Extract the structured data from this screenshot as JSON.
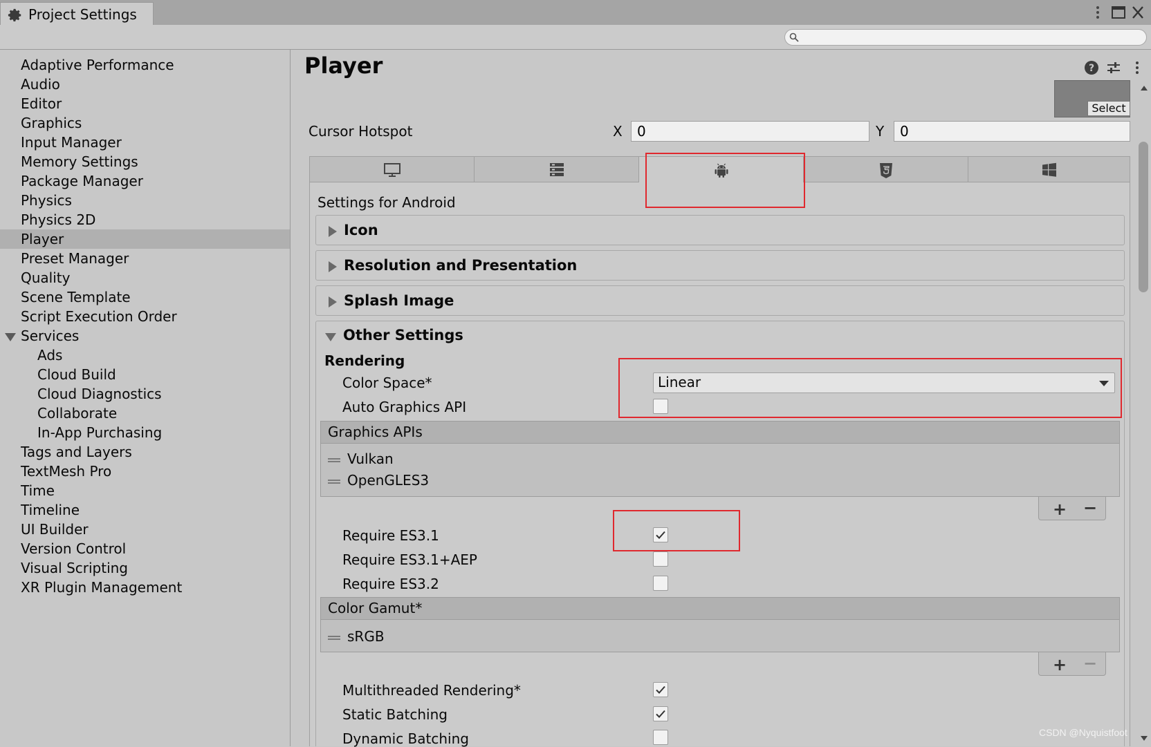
{
  "window": {
    "tab_title": "Project Settings",
    "search_placeholder": ""
  },
  "sidebar": {
    "items": [
      {
        "label": "Adaptive Performance"
      },
      {
        "label": "Audio"
      },
      {
        "label": "Editor"
      },
      {
        "label": "Graphics"
      },
      {
        "label": "Input Manager"
      },
      {
        "label": "Memory Settings"
      },
      {
        "label": "Package Manager"
      },
      {
        "label": "Physics"
      },
      {
        "label": "Physics 2D"
      },
      {
        "label": "Player"
      },
      {
        "label": "Preset Manager"
      },
      {
        "label": "Quality"
      },
      {
        "label": "Scene Template"
      },
      {
        "label": "Script Execution Order"
      },
      {
        "label": "Services"
      },
      {
        "label": "Ads"
      },
      {
        "label": "Cloud Build"
      },
      {
        "label": "Cloud Diagnostics"
      },
      {
        "label": "Collaborate"
      },
      {
        "label": "In-App Purchasing"
      },
      {
        "label": "Tags and Layers"
      },
      {
        "label": "TextMesh Pro"
      },
      {
        "label": "Time"
      },
      {
        "label": "Timeline"
      },
      {
        "label": "UI Builder"
      },
      {
        "label": "Version Control"
      },
      {
        "label": "Visual Scripting"
      },
      {
        "label": "XR Plugin Management"
      }
    ],
    "selected": "Player"
  },
  "main": {
    "title": "Player",
    "select_label": "Select",
    "cursor_hotspot": {
      "label": "Cursor Hotspot",
      "x_label": "X",
      "x_value": "0",
      "y_label": "Y",
      "y_value": "0"
    },
    "platform_tabs": [
      {
        "name": "standalone",
        "icon": "monitor-icon"
      },
      {
        "name": "server",
        "icon": "server-icon"
      },
      {
        "name": "android",
        "icon": "android-icon",
        "selected": true
      },
      {
        "name": "webgl",
        "icon": "html5-icon"
      },
      {
        "name": "windows",
        "icon": "windows-icon"
      }
    ],
    "settings_for": "Settings for Android",
    "sections": {
      "icon": "Icon",
      "resolution": "Resolution and Presentation",
      "splash": "Splash Image",
      "other": "Other Settings"
    },
    "rendering": {
      "header": "Rendering",
      "color_space_label": "Color Space*",
      "color_space_value": "Linear",
      "auto_graphics_api_label": "Auto Graphics API",
      "auto_graphics_api_checked": false,
      "graphics_apis_header": "Graphics APIs",
      "graphics_apis": [
        "Vulkan",
        "OpenGLES3"
      ],
      "require_es31_label": "Require ES3.1",
      "require_es31_checked": true,
      "require_es31_aep_label": "Require ES3.1+AEP",
      "require_es31_aep_checked": false,
      "require_es32_label": "Require ES3.2",
      "require_es32_checked": false,
      "color_gamut_header": "Color Gamut*",
      "color_gamut": [
        "sRGB"
      ],
      "multithreaded_label": "Multithreaded Rendering*",
      "multithreaded_checked": true,
      "static_batching_label": "Static Batching",
      "static_batching_checked": true,
      "dynamic_batching_label": "Dynamic Batching",
      "dynamic_batching_checked": false
    },
    "list_controls": {
      "plus": "+",
      "minus": "−"
    }
  },
  "watermark": "CSDN @Nyquistfoot",
  "colors": {
    "highlight_box": "#e0282e",
    "selected_sidebar": "#b0b0b0"
  }
}
